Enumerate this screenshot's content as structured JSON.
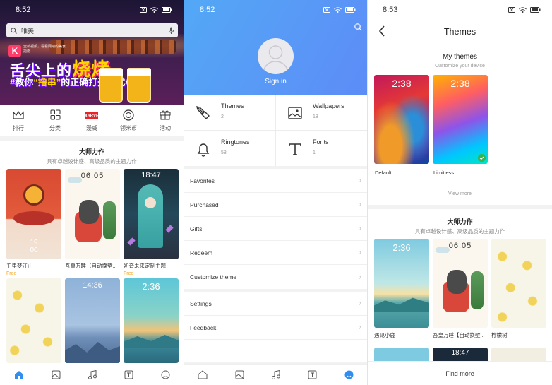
{
  "screen1": {
    "status": {
      "time": "8:52"
    },
    "search": {
      "placeholder": "唯美"
    },
    "banner": {
      "caption": "全新视频，看看网吧的美食指南",
      "headline_a": "舌尖上的",
      "headline_b": "烧烤",
      "sub_a": "#教你",
      "sub_b": "“撸串”",
      "sub_c": "的正确打开方式#"
    },
    "categories": [
      {
        "label": "排行",
        "icon": "crown-icon"
      },
      {
        "label": "分类",
        "icon": "grid-icon"
      },
      {
        "label": "漫威",
        "icon": "marvel-icon"
      },
      {
        "label": "领米币",
        "icon": "coin-icon"
      },
      {
        "label": "活动",
        "icon": "gift-icon"
      }
    ],
    "section": {
      "title": "大师力作",
      "subtitle": "具有卓越设计感、高级品质的主题力作"
    },
    "tiles": [
      {
        "name": "千里梦江山",
        "price": "Free",
        "clock": "19\n00"
      },
      {
        "name": "吾皇万睡【自动换壁...",
        "price": "",
        "clock": "06:05"
      },
      {
        "name": "初音未来定制主题",
        "price": "Free",
        "clock": "18:47"
      },
      {
        "name": "",
        "price": "",
        "clock": ""
      },
      {
        "name": "",
        "price": "",
        "clock": "14:36"
      },
      {
        "name": "",
        "price": "",
        "clock": "2:36"
      }
    ],
    "bottom_nav": [
      "home-icon",
      "wallpaper-icon",
      "music-icon",
      "font-icon",
      "profile-icon"
    ]
  },
  "screen2": {
    "status": {
      "time": "8:52"
    },
    "signin": "Sign in",
    "cards": [
      {
        "title": "Themes",
        "count": "2",
        "icon": "brush-icon"
      },
      {
        "title": "Wallpapers",
        "count": "18",
        "icon": "image-icon"
      },
      {
        "title": "Ringtones",
        "count": "58",
        "icon": "bell-icon"
      },
      {
        "title": "Fonts",
        "count": "1",
        "icon": "font-icon"
      }
    ],
    "list_a": [
      "Favorites",
      "Purchased",
      "Gifts",
      "Redeem",
      "Customize theme"
    ],
    "list_b": [
      "Settings",
      "Feedback"
    ],
    "bottom_nav": [
      "home-icon",
      "wallpaper-icon",
      "music-icon",
      "font-icon",
      "profile-icon"
    ]
  },
  "screen3": {
    "status": {
      "time": "8:53"
    },
    "title": "Themes",
    "my_themes": {
      "title": "My themes",
      "subtitle": "Customize your device",
      "items": [
        {
          "label": "Default",
          "clock": "2:38"
        },
        {
          "label": "Limitless",
          "clock": "2:38"
        }
      ],
      "view_more": "View more"
    },
    "section": {
      "title": "大师力作",
      "subtitle": "具有卓越设计感、高级品质的主题力作"
    },
    "tiles": [
      {
        "name": "遇见小鹿",
        "clock": "2:36"
      },
      {
        "name": "吾皇万睡【自动换壁...",
        "clock": "06:05"
      },
      {
        "name": "柠檬树",
        "clock": ""
      }
    ],
    "find_more": "Find more",
    "row2_clock": "18:47"
  }
}
